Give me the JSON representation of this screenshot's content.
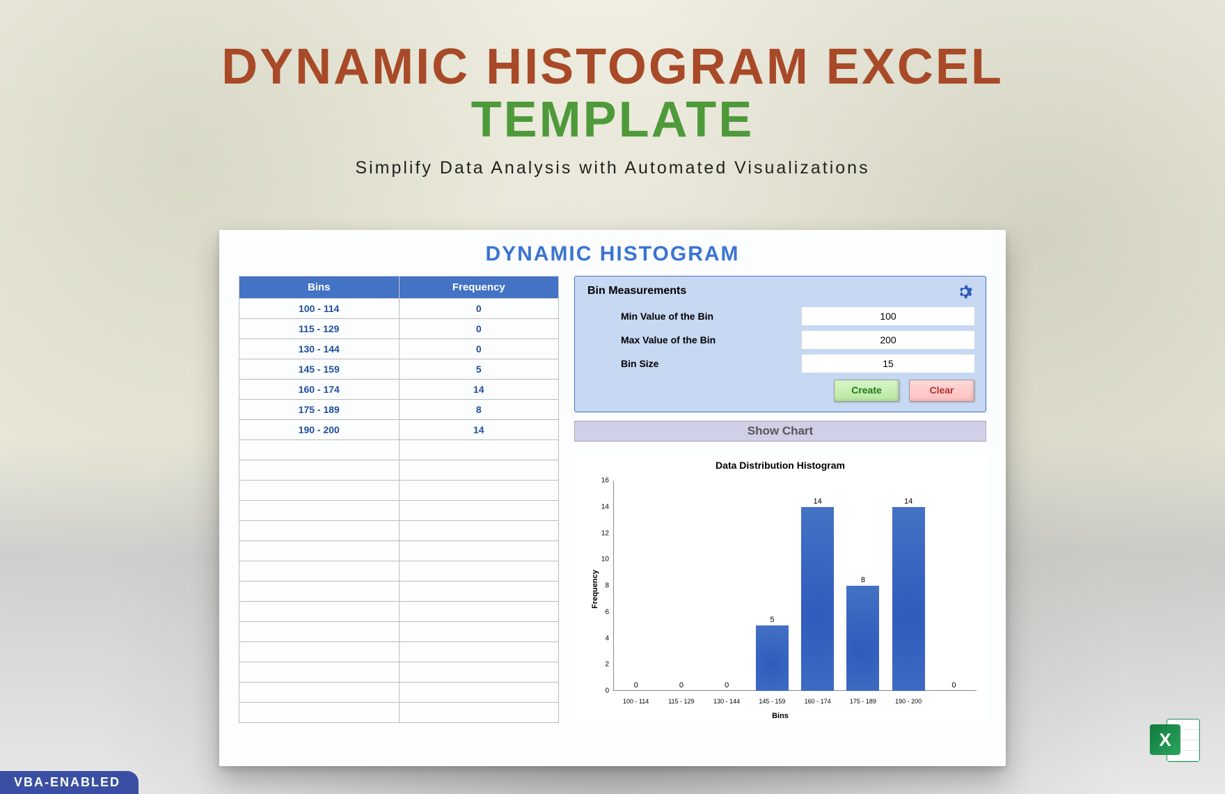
{
  "hero": {
    "title_line1": "DYNAMIC HISTOGRAM EXCEL",
    "title_line2": "TEMPLATE",
    "title_color1": "#a84a28",
    "title_color2": "#4e9a3a",
    "subtitle": "Simplify Data Analysis with Automated Visualizations"
  },
  "card": {
    "title": "DYNAMIC HISTOGRAM",
    "title_color": "#3a74d0"
  },
  "table": {
    "header_bins": "Bins",
    "header_freq": "Frequency",
    "rows": [
      {
        "bin": "100 - 114",
        "freq": "0"
      },
      {
        "bin": "115 - 129",
        "freq": "0"
      },
      {
        "bin": "130 - 144",
        "freq": "0"
      },
      {
        "bin": "145 - 159",
        "freq": "5"
      },
      {
        "bin": "160 - 174",
        "freq": "14"
      },
      {
        "bin": "175 - 189",
        "freq": "8"
      },
      {
        "bin": "190 - 200",
        "freq": "14"
      }
    ],
    "empty_rows": 14
  },
  "bin_panel": {
    "title": "Bin Measurements",
    "fields": {
      "min_label": "Min Value of the Bin",
      "min_value": "100",
      "max_label": "Max Value of the Bin",
      "max_value": "200",
      "size_label": "Bin Size",
      "size_value": "15"
    },
    "create_label": "Create",
    "clear_label": "Clear"
  },
  "show_chart_label": "Show Chart",
  "chart_data": {
    "type": "bar",
    "title": "Data Distribution Histogram",
    "xlabel": "Bins",
    "ylabel": "Frequency",
    "ylim": [
      0,
      16
    ],
    "yticks": [
      0,
      2,
      4,
      6,
      8,
      10,
      12,
      14,
      16
    ],
    "categories": [
      "100 - 114",
      "115 - 129",
      "130 - 144",
      "145 - 159",
      "160 - 174",
      "175 - 189",
      "190 - 200",
      ""
    ],
    "values": [
      0,
      0,
      0,
      5,
      14,
      8,
      14,
      0
    ],
    "bar_color": "#4472c4"
  },
  "vba_badge": "VBA-ENABLED",
  "excel_letter": "X"
}
